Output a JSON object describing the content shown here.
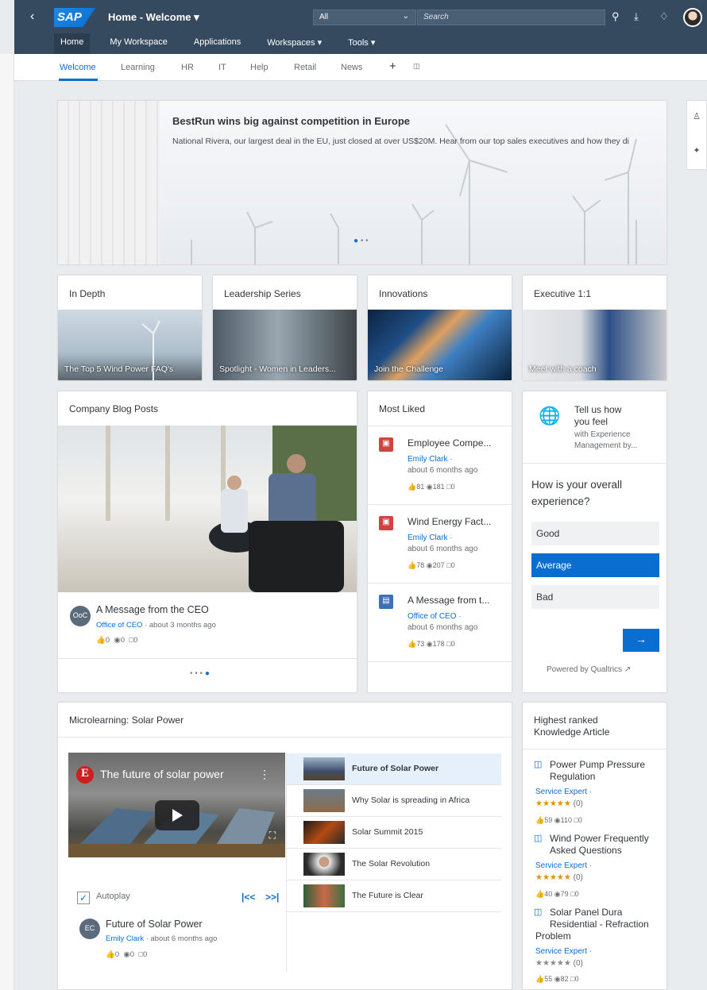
{
  "shell": {
    "title": "Home - Welcome ▾",
    "logo": "SAP",
    "scope": "All",
    "search_placeholder": "Search",
    "menu": [
      "Home",
      "My Workspace",
      "Applications",
      "Workspaces ▾",
      "Tools ▾"
    ]
  },
  "tabs": [
    "Welcome",
    "Learning",
    "HR",
    "IT",
    "Help",
    "Retail",
    "News"
  ],
  "hero": {
    "title": "BestRun wins big against competition in Europe",
    "text": "National Rivera, our largest deal in the EU, just closed at over US$20M. Hear from our top sales executives and how they di"
  },
  "tiles": [
    {
      "title": "In Depth",
      "caption": "The Top 5 Wind Power FAQ's"
    },
    {
      "title": "Leadership Series",
      "caption": "Spotlight - Women in Leaders..."
    },
    {
      "title": "Innovations",
      "caption": "Join the Challenge"
    },
    {
      "title": "Executive 1:1",
      "caption": "Meet with a coach"
    }
  ],
  "blog": {
    "title": "Company Blog Posts",
    "avatar": "OoC",
    "post_title": "A Message from the CEO",
    "author": "Office of CEO",
    "time": "· about 3 months ago",
    "likes": "0",
    "views": "0",
    "comments": "0"
  },
  "most_liked": {
    "title": "Most Liked",
    "items": [
      {
        "title": "Employee Compe...",
        "author": "Emily Clark",
        "time": "about 6 months ago",
        "likes": "81",
        "views": "181",
        "comments": "0",
        "color": "#d04343"
      },
      {
        "title": "Wind Energy Fact...",
        "author": "Emily Clark",
        "time": "about 6 months ago",
        "likes": "78",
        "views": "207",
        "comments": "0",
        "color": "#d04343"
      },
      {
        "title": "A Message from t...",
        "author": "Office of CEO",
        "time": "about 6 months ago",
        "likes": "73",
        "views": "178",
        "comments": "0",
        "color": "#3f6fb5"
      }
    ]
  },
  "survey": {
    "header1": "Tell us how",
    "header2": "you feel",
    "sub1": "with Experience",
    "sub2": "Management by...",
    "question1": "How is your overall",
    "question2": "experience?",
    "options": [
      "Good",
      "Average",
      "Bad"
    ],
    "selected": "Average",
    "submit": "→",
    "powered": "Powered by Qualtrics"
  },
  "micro": {
    "title": "Microlearning: Solar Power",
    "video_title": "The future of solar power",
    "video_channel": "E",
    "autoplay_label": "Autoplay",
    "prev": "|<<",
    "next": ">>|",
    "avatar": "EC",
    "post_title": "Future of Solar Power",
    "author": "Emily Clark",
    "time": "· about 6 months ago",
    "likes": "0",
    "views": "0",
    "comments": "0",
    "playlist": [
      "Future of Solar Power",
      "Why Solar is spreading in Africa",
      "Solar Summit 2015",
      "The Solar Revolution",
      "The Future is Clear"
    ]
  },
  "knowledge": {
    "title1": "Highest ranked",
    "title2": "Knowledge Article",
    "items": [
      {
        "title1": "Power Pump Pressure",
        "title2": "Regulation",
        "author": "Service Expert",
        "rating": "(0)",
        "likes": "59",
        "views": "110",
        "comments": "0"
      },
      {
        "title1": "Wind Power Frequently",
        "title2": "Asked Questions",
        "author": "Service Expert",
        "rating": "(0)",
        "likes": "40",
        "views": "79",
        "comments": "0"
      },
      {
        "title1": "Solar Panel Dura",
        "title2": "Residential - Refraction",
        "title3": "Problem",
        "author": "Service Expert",
        "rating": "(0)",
        "likes": "55",
        "views": "82",
        "comments": "0"
      }
    ]
  }
}
